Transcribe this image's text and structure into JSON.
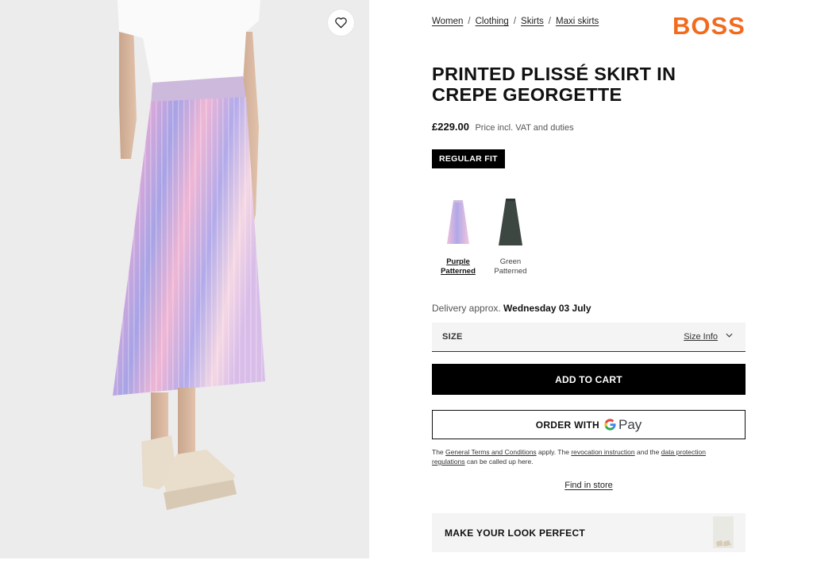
{
  "breadcrumb": [
    {
      "label": "Women"
    },
    {
      "label": "Clothing"
    },
    {
      "label": "Skirts"
    },
    {
      "label": "Maxi skirts"
    }
  ],
  "breadcrumb_separator": "/",
  "brand": "BOSS",
  "product": {
    "title": "PRINTED PLISSÉ SKIRT IN CREPE GEORGETTE",
    "price": "£229.00",
    "price_note": "Price incl. VAT and duties",
    "fit_badge": "REGULAR FIT"
  },
  "colors": {
    "swatches": [
      {
        "label": "Purple Patterned",
        "selected": true
      },
      {
        "label": "Green Patterned",
        "selected": false
      }
    ]
  },
  "delivery": {
    "prefix": "Delivery approx.",
    "date": "Wednesday 03 July"
  },
  "size": {
    "label": "SIZE",
    "info_link": "Size Info"
  },
  "buttons": {
    "add_to_cart": "ADD TO CART",
    "order_with": "ORDER WITH",
    "gpay_pay": "Pay"
  },
  "terms": {
    "t1": "The ",
    "link1": "General Terms and Conditions",
    "t2": " apply. The ",
    "link2": "revocation instruction",
    "t3": " and the ",
    "link3": "data protection regulations",
    "t4": " can be called up here."
  },
  "find_in_store": "Find in store",
  "look": {
    "title": "MAKE YOUR LOOK PERFECT"
  },
  "theme": {
    "brand_color": "#f26b1d",
    "button_bg": "#000000",
    "panel_bg": "#f4f4f4"
  }
}
